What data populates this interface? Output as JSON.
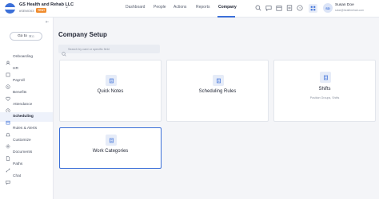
{
  "org": {
    "name": "GS Health and Rehab LLC",
    "id": "#SEMO03",
    "badge": "TEST"
  },
  "nav": {
    "dashboard": "Dashboard",
    "people": "People",
    "actions": "Actions",
    "reports": "Reports",
    "company": "Company"
  },
  "user": {
    "initials": "SD",
    "name": "Susan Doe",
    "email": "sdoe@healthrehab.com"
  },
  "sidebar": {
    "goto_label": "Go to",
    "goto_shortcut": "⌘G",
    "items": [
      {
        "label": "Onboarding",
        "icon": "onboarding-icon"
      },
      {
        "label": "HR",
        "icon": "hr-icon"
      },
      {
        "label": "Payroll",
        "icon": "payroll-icon"
      },
      {
        "label": "Benefits",
        "icon": "benefits-icon"
      },
      {
        "label": "Attendance",
        "icon": "attendance-icon"
      },
      {
        "label": "Scheduling",
        "icon": "scheduling-icon",
        "active": true
      },
      {
        "label": "Rules & Alerts",
        "icon": "rules-alerts-icon"
      },
      {
        "label": "Customize",
        "icon": "customize-icon"
      },
      {
        "label": "Documents",
        "icon": "documents-icon"
      },
      {
        "label": "Paths",
        "icon": "paths-icon"
      },
      {
        "label": "Chat",
        "icon": "chat-icon"
      }
    ]
  },
  "main": {
    "title": "Company Setup",
    "search_placeholder": "Search by card or specific field",
    "cards": [
      {
        "title": "Quick Notes",
        "subtitle": ""
      },
      {
        "title": "Scheduling Rules",
        "subtitle": ""
      },
      {
        "title": "Shifts",
        "subtitle": "Position Groups, Shifts"
      },
      {
        "title": "Work Categories",
        "subtitle": ""
      }
    ]
  },
  "colors": {
    "accent": "#3b6fd8",
    "badge": "#f08c2e",
    "background": "#f4f5f8"
  }
}
